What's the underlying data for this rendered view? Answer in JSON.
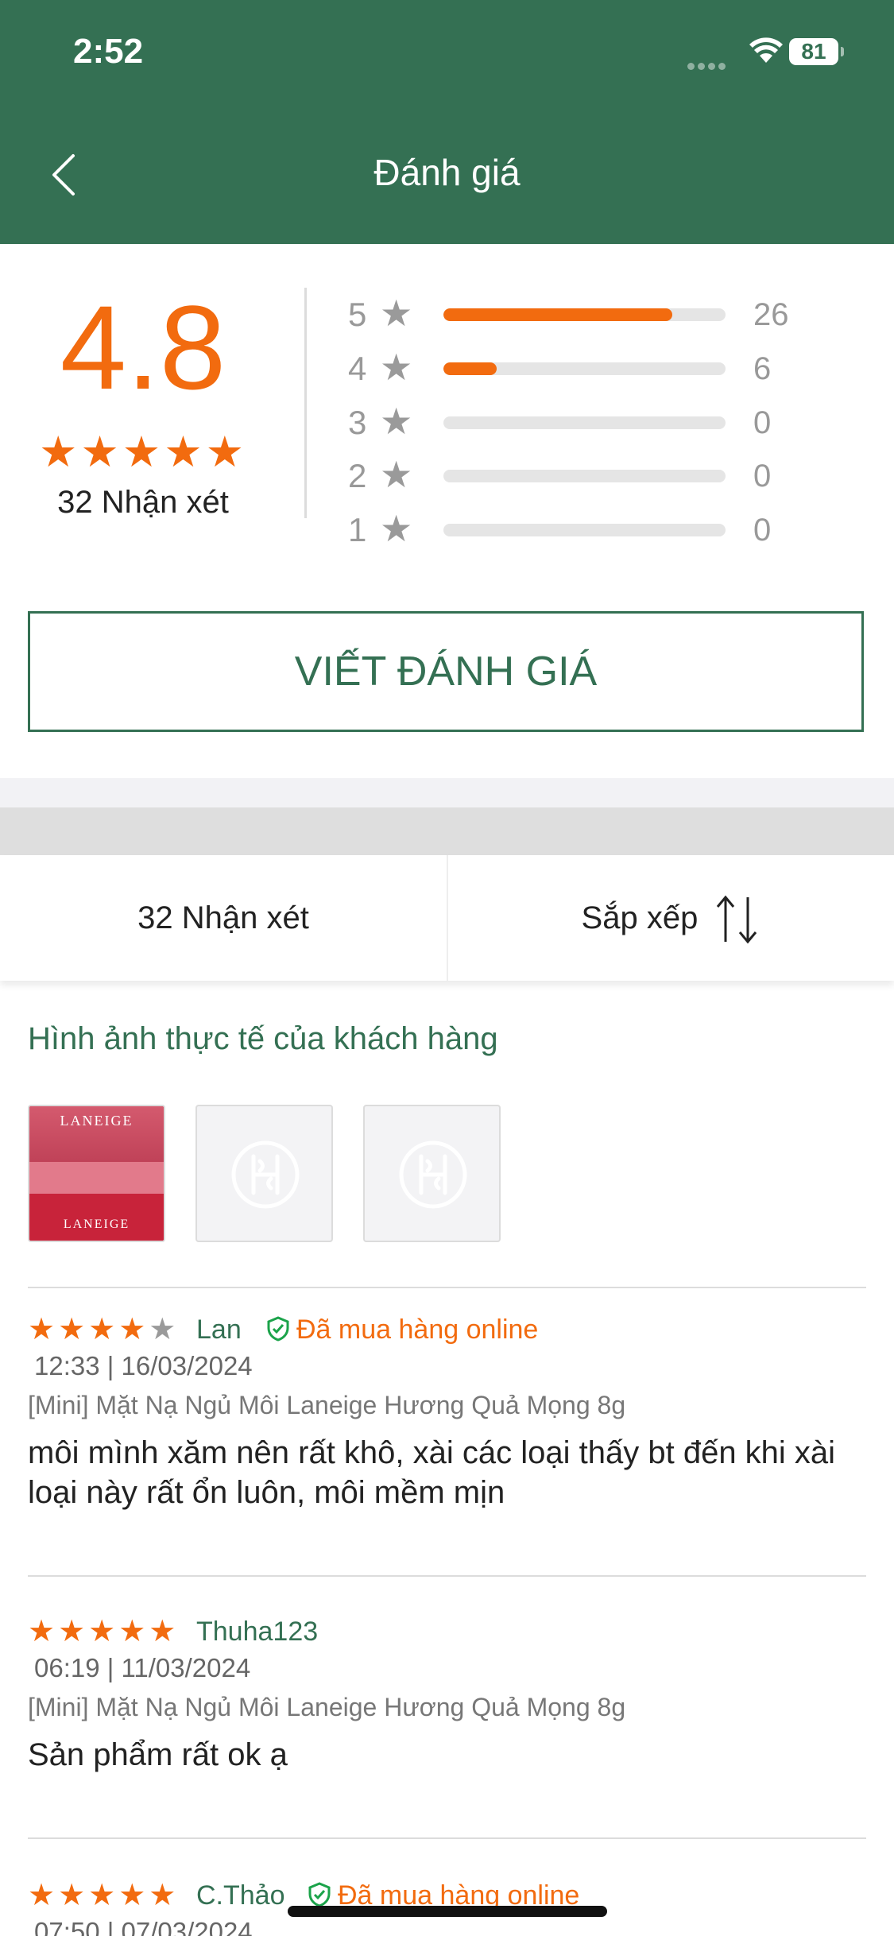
{
  "status_bar": {
    "time": "2:52",
    "battery": "81"
  },
  "header": {
    "title": "Đánh giá"
  },
  "summary": {
    "average": "4.8",
    "stars": "★★★★★",
    "total_label": "32 Nhận xét",
    "distribution": [
      {
        "stars": "5",
        "count": "26",
        "fraction": 0.81
      },
      {
        "stars": "4",
        "count": "6",
        "fraction": 0.19
      },
      {
        "stars": "3",
        "count": "0",
        "fraction": 0
      },
      {
        "stars": "2",
        "count": "0",
        "fraction": 0
      },
      {
        "stars": "1",
        "count": "0",
        "fraction": 0
      }
    ]
  },
  "write_button": "VIẾT ĐÁNH GIÁ",
  "tabs": {
    "count_label": "32 Nhận xét",
    "sort_label": "Sắp xếp"
  },
  "photos": {
    "title": "Hình ảnh thực tế của khách hàng",
    "brand": "LANEIGE"
  },
  "reviews": [
    {
      "stars_on": "★★★★",
      "stars_off": "★",
      "user": "Lan",
      "badge": "Đã mua hàng online",
      "date": "12:33 | 16/03/2024",
      "product": "[Mini] Mặt Nạ Ngủ Môi Laneige Hương Quả Mọng 8g",
      "text": "môi mình xăm nên rất khô, xài các loại thấy bt đến khi xài loại này rất ổn luôn, môi mềm mịn"
    },
    {
      "stars_on": "★★★★★",
      "stars_off": "",
      "user": "Thuha123",
      "badge": "",
      "date": "06:19 | 11/03/2024",
      "product": "[Mini] Mặt Nạ Ngủ Môi Laneige Hương Quả Mọng 8g",
      "text": "Sản phẩm rất ok ạ"
    },
    {
      "stars_on": "★★★★★",
      "stars_off": "",
      "user": "C.Thảo",
      "badge": "Đã mua hàng online",
      "date": "07:50 | 07/03/2024",
      "product": "",
      "text": ""
    }
  ],
  "colors": {
    "brand_green": "#347053",
    "accent_orange": "#f26b0f"
  }
}
